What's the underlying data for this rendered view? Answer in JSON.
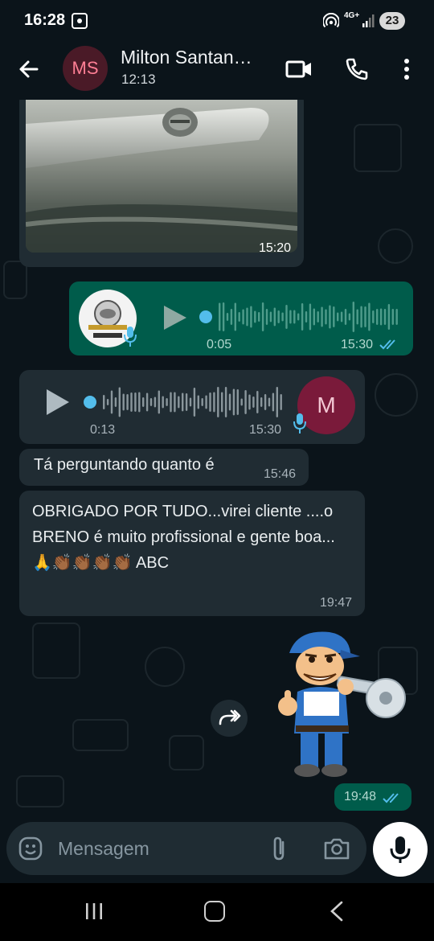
{
  "status_bar": {
    "time": "16:28",
    "network": "4G+",
    "battery": "23"
  },
  "header": {
    "avatar_initials": "MS",
    "contact_name": "Milton Santan…",
    "contact_status": "12:13"
  },
  "messages": {
    "image": {
      "time": "15:20"
    },
    "voice_out": {
      "duration": "0:05",
      "time": "15:30",
      "read": true
    },
    "voice_in": {
      "duration": "0:13",
      "time": "15:30",
      "avatar_initial": "M"
    },
    "text_1": {
      "body": "Tá perguntando quanto é",
      "time": "15:46"
    },
    "text_2": {
      "body": "OBRIGADO POR TUDO...virei cliente ....o BRENO é muito profissional e gente boa... 🙏👏🏾👏🏾👏🏾👏🏾 ABC",
      "time": "19:47"
    },
    "sticker": {
      "time": "19:48",
      "read": true
    }
  },
  "input": {
    "placeholder": "Mensagem"
  },
  "colors": {
    "background": "#0b141a",
    "incoming_bubble": "#202c33",
    "outgoing_bubble": "#005c4b",
    "read_ticks": "#53bdeb",
    "audio_progress": "#53bdeb"
  },
  "icons": {
    "header": [
      "back-arrow-icon",
      "video-camera-icon",
      "phone-icon",
      "more-vert-icon"
    ],
    "input": [
      "emoji-icon",
      "paperclip-icon",
      "camera-icon",
      "microphone-icon"
    ],
    "nav": [
      "recents-icon",
      "home-icon",
      "back-icon"
    ]
  }
}
